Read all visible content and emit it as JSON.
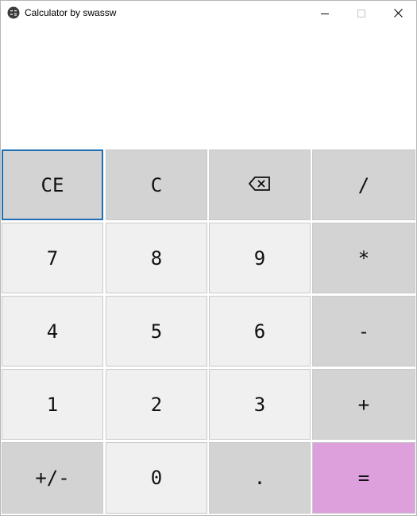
{
  "window": {
    "title": "Calculator by swassw"
  },
  "display": {
    "value": ""
  },
  "keys": {
    "ce": "CE",
    "c": "C",
    "backspace": "⌫",
    "divide": "/",
    "seven": "7",
    "eight": "8",
    "nine": "9",
    "multiply": "*",
    "four": "4",
    "five": "5",
    "six": "6",
    "minus": "-",
    "one": "1",
    "two": "2",
    "three": "3",
    "plus": "+",
    "negate": "+/-",
    "zero": "0",
    "decimal": ".",
    "equals": "="
  },
  "colors": {
    "operator_key": "#d3d3d3",
    "number_key": "#f0f0f0",
    "equals_key": "#dda0dd",
    "focus_border": "#1f6fb5"
  }
}
